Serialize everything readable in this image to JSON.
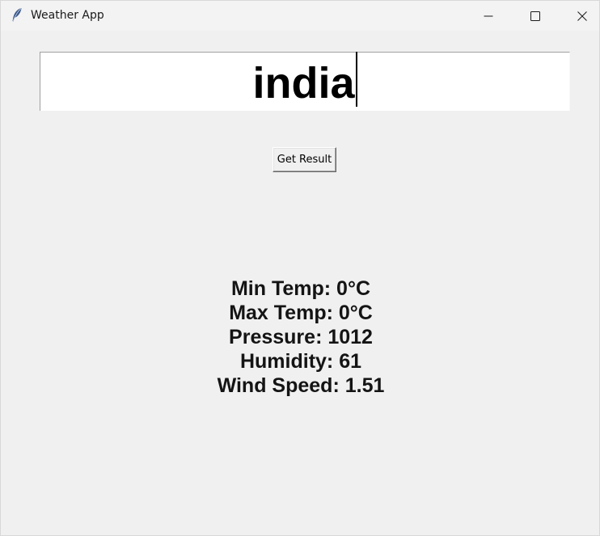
{
  "window": {
    "title": "Weather App"
  },
  "icons": {
    "app": "feather-icon",
    "minimize": "minimize-icon",
    "maximize": "maximize-icon",
    "close": "close-icon"
  },
  "search": {
    "value": "india"
  },
  "button": {
    "label": "Get Result"
  },
  "results": {
    "min_temp": "Min Temp: 0°C",
    "max_temp": "Max Temp: 0°C",
    "pressure": "Pressure: 1012",
    "humidity": "Humidity: 61",
    "wind_speed": "Wind Speed: 1.51"
  },
  "colors": {
    "background": "#f0f0f0",
    "entry_background": "#ffffff",
    "text": "#000000"
  }
}
